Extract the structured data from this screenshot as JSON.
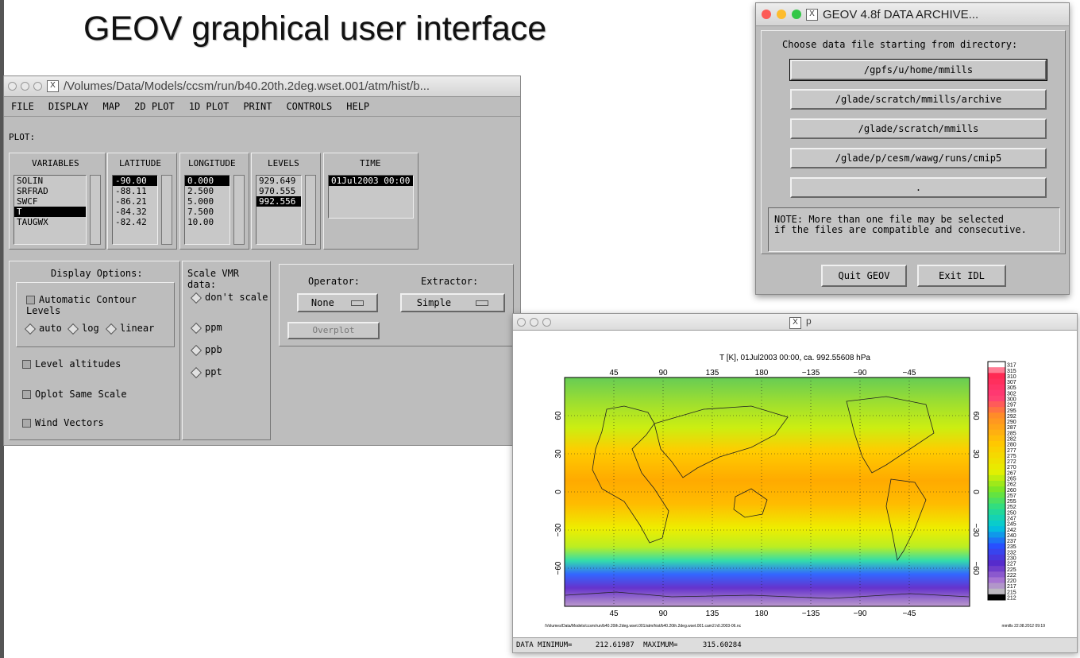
{
  "slide": {
    "title": "GEOV graphical user interface"
  },
  "main_window": {
    "title": "/Volumes/Data/Models/ccsm/run/b40.20th.2deg.wset.001/atm/hist/b...",
    "menu": [
      "FILE",
      "DISPLAY",
      "MAP",
      "2D PLOT",
      "1D PLOT",
      "PRINT",
      "CONTROLS",
      "HELP"
    ],
    "plot_label": "PLOT:",
    "variables": {
      "header": "VARIABLES",
      "items": [
        "SOLIN",
        "SRFRAD",
        "SWCF",
        "T",
        "TAUGWX"
      ],
      "selected": 3
    },
    "latitude": {
      "header": "LATITUDE",
      "items": [
        "-90.00",
        "-88.11",
        "-86.21",
        "-84.32",
        "-82.42"
      ],
      "selected": 0
    },
    "longitude": {
      "header": "LONGITUDE",
      "items": [
        "0.000",
        "2.500",
        "5.000",
        "7.500",
        "10.00"
      ],
      "selected": 0
    },
    "levels": {
      "header": "LEVELS",
      "items": [
        "929.649",
        "970.555",
        "992.556"
      ],
      "selected": 2
    },
    "time": {
      "header": "TIME",
      "items": [
        "01Jul2003 00:00"
      ],
      "selected": 0
    },
    "display_options": {
      "header": "Display Options:",
      "auto_contour": "Automatic Contour Levels",
      "radios": [
        "auto",
        "log",
        "linear"
      ],
      "level_altitudes": "Level altitudes",
      "oplot_same_scale": "Oplot Same Scale",
      "wind_vectors": "Wind Vectors"
    },
    "scale_vmr": {
      "header": "Scale VMR data:",
      "options": [
        "don't scale",
        "ppm",
        "ppb",
        "ppt"
      ]
    },
    "operator": {
      "label": "Operator:",
      "value": "None"
    },
    "extractor": {
      "label": "Extractor:",
      "value": "Simple"
    },
    "overplot_label": "Overplot"
  },
  "archive_window": {
    "title": "GEOV 4.8f DATA ARCHIVE...",
    "prompt": "Choose data file starting from directory:",
    "dirs": [
      "/gpfs/u/home/mmills",
      "/glade/scratch/mmills/archive",
      "/glade/scratch/mmills",
      "/glade/p/cesm/wawg/runs/cmip5",
      "."
    ],
    "note_line1": "NOTE: More than one file may be selected",
    "note_line2": "if the files are compatible and consecutive.",
    "quit_label": "Quit GEOV",
    "exit_label": "Exit IDL"
  },
  "plot_window": {
    "title": "p",
    "plot_title": "T [K], 01Jul2003 00:00, ca. 992.55608 hPa",
    "lon_ticks": [
      "45",
      "90",
      "135",
      "180",
      "−135",
      "−90",
      "−45"
    ],
    "lat_ticks": [
      "60",
      "30",
      "0",
      "−30",
      "−60"
    ],
    "colorbar_labels": [
      "317",
      "315",
      "310",
      "307",
      "305",
      "302",
      "300",
      "297",
      "295",
      "292",
      "290",
      "287",
      "285",
      "282",
      "280",
      "277",
      "275",
      "272",
      "270",
      "267",
      "265",
      "262",
      "260",
      "257",
      "255",
      "252",
      "250",
      "247",
      "245",
      "242",
      "240",
      "237",
      "235",
      "232",
      "230",
      "227",
      "225",
      "222",
      "220",
      "217",
      "215",
      "212"
    ],
    "footer_path": "/Volumes/Data/Models/ccsm/run/b40.20th.2deg.wset.001/atm/hist/b40.20th.2deg.wset.001.cam2.h0.2003-06.nc",
    "footer_stamp": "mmills 22.08.2012 09:19",
    "status_min_label": "DATA MINIMUM=",
    "status_min": "212.61987",
    "status_max_label": "MAXIMUM=",
    "status_max": "315.60284"
  }
}
